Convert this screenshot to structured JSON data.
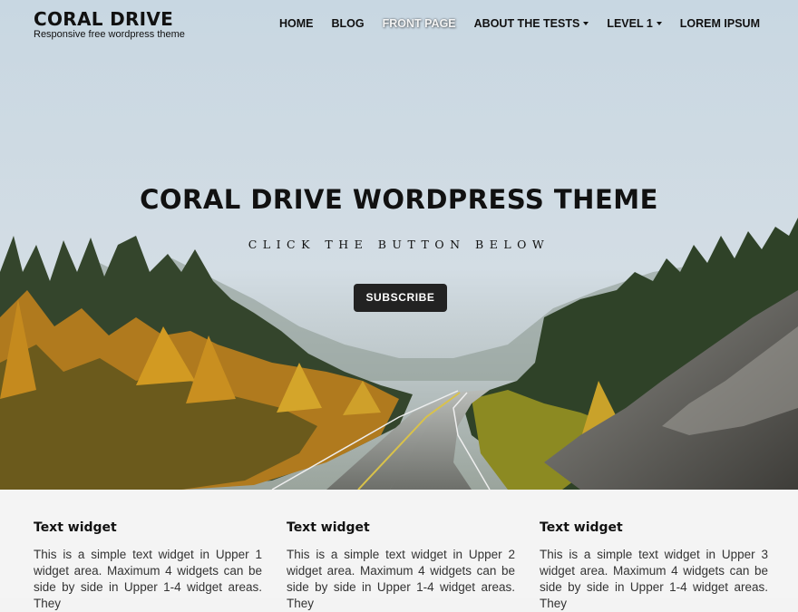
{
  "site": {
    "title": "CORAL DRIVE",
    "tagline": "Responsive free wordpress theme"
  },
  "nav": {
    "items": [
      {
        "label": "HOME",
        "active": false,
        "has_submenu": false
      },
      {
        "label": "BLOG",
        "active": false,
        "has_submenu": false
      },
      {
        "label": "FRONT PAGE",
        "active": true,
        "has_submenu": false
      },
      {
        "label": "ABOUT THE TESTS",
        "active": false,
        "has_submenu": true
      },
      {
        "label": "LEVEL 1",
        "active": false,
        "has_submenu": true
      },
      {
        "label": "LOREM IPSUM",
        "active": false,
        "has_submenu": false
      }
    ]
  },
  "hero": {
    "title": "CORAL DRIVE WORDPRESS THEME",
    "subtitle": "CLICK THE BUTTON BELOW",
    "button_label": "SUBSCRIBE"
  },
  "widgets": [
    {
      "title": "Text widget",
      "text": "This is a simple text widget in Upper 1 widget area. Maximum 4 widgets can be side by side in Upper 1-4 widget areas. They"
    },
    {
      "title": "Text widget",
      "text": "This is a simple text widget in Upper 2 widget area. Maximum 4 widgets can be side by side in Upper 1-4 widget areas. They"
    },
    {
      "title": "Text widget",
      "text": "This is a simple text widget in Upper 3 widget area. Maximum 4 widgets can be side by side in Upper 1-4 widget areas. They"
    }
  ],
  "colors": {
    "button_bg": "#222222",
    "text_dark": "#111111",
    "widget_bg": "#f4f4f4"
  }
}
